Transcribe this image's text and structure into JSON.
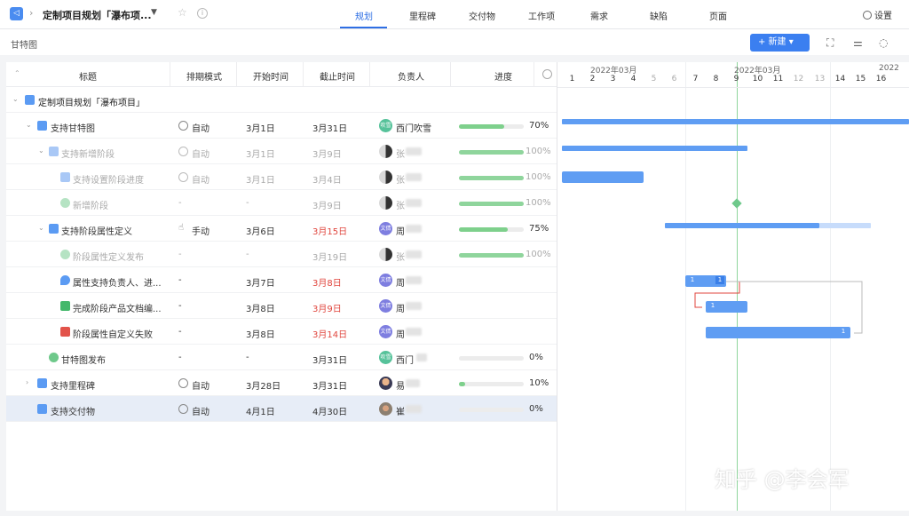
{
  "topbar": {
    "project_title": "定制项目规划「瀑布项...",
    "tabs": [
      {
        "label": "规划",
        "active": true
      },
      {
        "label": "里程碑"
      },
      {
        "label": "交付物"
      },
      {
        "label": "工作项"
      },
      {
        "label": "需求"
      },
      {
        "label": "缺陷"
      },
      {
        "label": "页面"
      }
    ],
    "settings_label": "设置"
  },
  "subbar": {
    "view_name": "甘特图",
    "new_button": "+ 新建 ▾"
  },
  "table": {
    "columns": [
      "标题",
      "排期模式",
      "开始时间",
      "截止时间",
      "负责人",
      "进度"
    ],
    "rows": [
      {
        "title": "定制项目规划「瀑布项目」",
        "mode": "",
        "start": "",
        "end": "",
        "owner": "",
        "avatar_text": "",
        "progress": null,
        "progress_label": ""
      },
      {
        "title": "支持甘特图",
        "mode": "自动",
        "start": "3月1日",
        "end": "3月31日",
        "owner": "西门吹雪",
        "avatar_text": "吹雪",
        "progress": 70,
        "progress_label": "70%"
      },
      {
        "title": "支持新增阶段",
        "mode": "自动",
        "start": "3月1日",
        "end": "3月9日",
        "owner": "张",
        "avatar_text": "",
        "progress": 100,
        "progress_label": "100%"
      },
      {
        "title": "支持设置阶段进度",
        "mode": "自动",
        "start": "3月1日",
        "end": "3月4日",
        "owner": "张",
        "avatar_text": "",
        "progress": 100,
        "progress_label": "100%"
      },
      {
        "title": "新增阶段",
        "mode": "-",
        "start": "-",
        "end": "3月9日",
        "owner": "张",
        "avatar_text": "",
        "progress": 100,
        "progress_label": "100%"
      },
      {
        "title": "支持阶段属性定义",
        "mode": "手动",
        "start": "3月6日",
        "end": "3月15日",
        "owner": "周",
        "avatar_text": "文倩",
        "progress": 75,
        "progress_label": "75%"
      },
      {
        "title": "阶段属性定义发布",
        "mode": "-",
        "start": "-",
        "end": "3月19日",
        "owner": "张",
        "avatar_text": "",
        "progress": 100,
        "progress_label": "100%"
      },
      {
        "title": "属性支持负责人、进...",
        "mode": "-",
        "start": "3月7日",
        "end": "3月8日",
        "owner": "周",
        "avatar_text": "文倩",
        "progress": null,
        "progress_label": ""
      },
      {
        "title": "完成阶段产品文档编...",
        "mode": "-",
        "start": "3月8日",
        "end": "3月9日",
        "owner": "周",
        "avatar_text": "文倩",
        "progress": null,
        "progress_label": ""
      },
      {
        "title": "阶段属性自定义失败",
        "mode": "-",
        "start": "3月8日",
        "end": "3月14日",
        "owner": "周",
        "avatar_text": "文倩",
        "progress": null,
        "progress_label": ""
      },
      {
        "title": "甘特图发布",
        "mode": "-",
        "start": "-",
        "end": "3月31日",
        "owner": "西门",
        "avatar_text": "吹雪",
        "progress": 0,
        "progress_label": "0%"
      },
      {
        "title": "支持里程碑",
        "mode": "自动",
        "start": "3月28日",
        "end": "3月31日",
        "owner": "易",
        "avatar_text": "",
        "progress": 10,
        "progress_label": "10%"
      },
      {
        "title": "支持交付物",
        "mode": "自动",
        "start": "4月1日",
        "end": "4月30日",
        "owner": "崔",
        "avatar_text": "",
        "progress": 0,
        "progress_label": "0%"
      }
    ]
  },
  "gantt": {
    "months": [
      "2022年03月",
      "2022年03月",
      "2022"
    ],
    "days": [
      "1",
      "2",
      "3",
      "4",
      "5",
      "6",
      "7",
      "8",
      "9",
      "10",
      "11",
      "12",
      "13",
      "14",
      "15",
      "16"
    ],
    "weekend_days": [
      "5",
      "6",
      "12",
      "13"
    ],
    "today_day": "9",
    "badges": [
      "1",
      "1",
      "1",
      "1"
    ]
  },
  "colors": {
    "accent": "#2f6fe4",
    "bar": "#5f9df3",
    "progress": "#7ed08c",
    "overdue": "#e0453d"
  },
  "watermark": "知乎 @李会军"
}
